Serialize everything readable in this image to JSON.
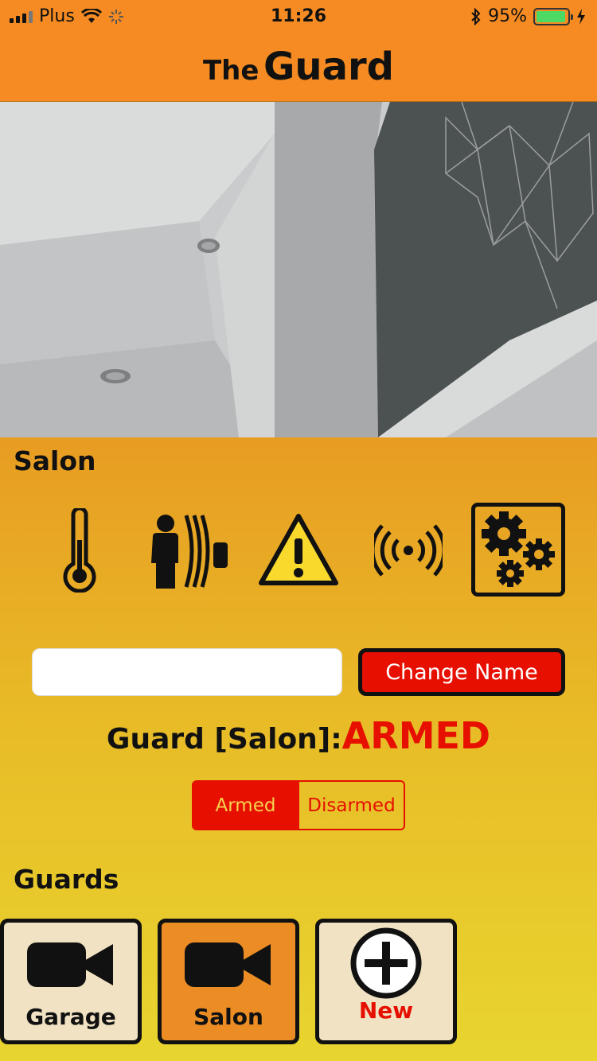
{
  "status_bar": {
    "carrier": "Plus",
    "time": "11:26",
    "battery_percent": "95%",
    "battery_level": 0.95,
    "icons": [
      "signal-icon",
      "wifi-icon",
      "activity-icon",
      "bluetooth-icon",
      "battery-icon",
      "charging-icon"
    ]
  },
  "header": {
    "title_small": "The",
    "title_large": "Guard"
  },
  "camera": {
    "icon": "camera-feed-image"
  },
  "room": {
    "title": "Salon"
  },
  "controls": {
    "icons": [
      "thermometer-icon",
      "motion-sensor-icon",
      "warning-icon",
      "signal-broadcast-icon",
      "settings-gears-icon"
    ]
  },
  "rename": {
    "input_value": "",
    "input_placeholder": "",
    "button_label": "Change Name"
  },
  "guard_status": {
    "label": "Guard [Salon]:",
    "state": "ARMED"
  },
  "mode_toggle": {
    "options": [
      "Armed",
      "Disarmed"
    ],
    "selected": "Armed"
  },
  "guards": {
    "title": "Guards",
    "items": [
      {
        "label": "Garage",
        "icon": "video-camera-icon",
        "selected": false
      },
      {
        "label": "Salon",
        "icon": "video-camera-icon",
        "selected": true
      },
      {
        "label": "New",
        "icon": "add-circle-icon",
        "selected": false
      }
    ]
  },
  "colors": {
    "header_orange": "#f58b22",
    "accent_red": "#e60f00",
    "card_beige": "#f0e2c2",
    "card_selected": "#eb8c24"
  }
}
